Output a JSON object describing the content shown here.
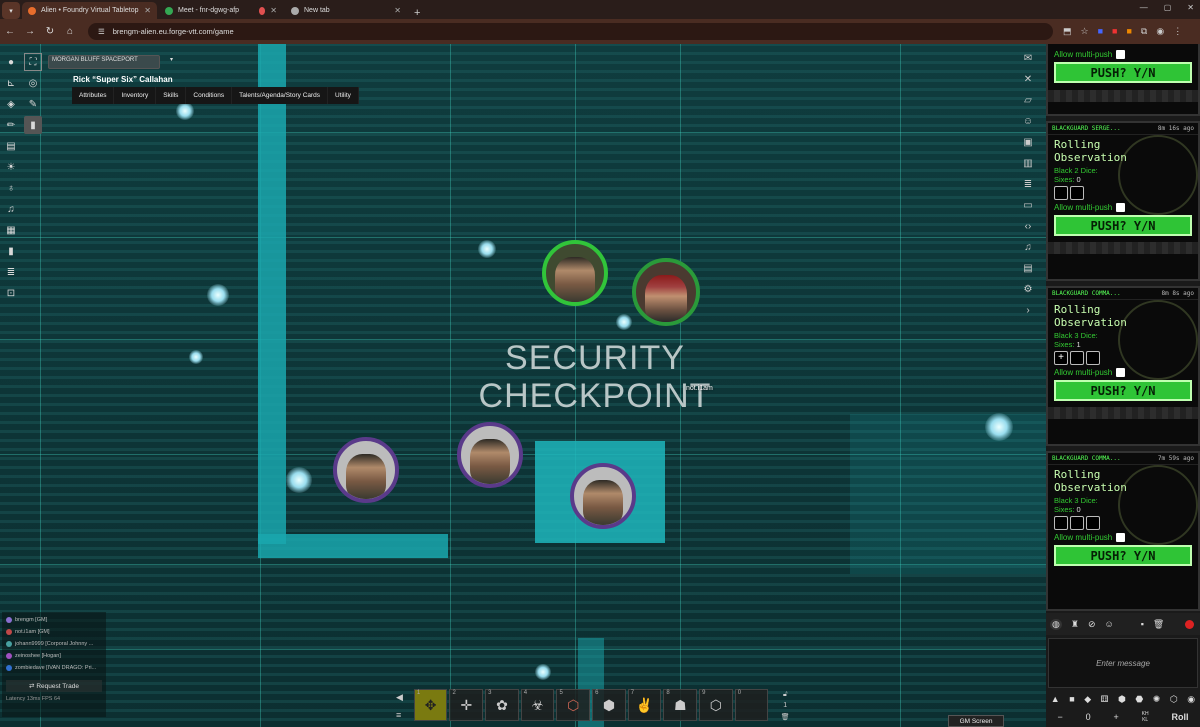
{
  "browser": {
    "tabs": [
      {
        "title": "Alien • Foundry Virtual Tabletop",
        "active": true,
        "favicon_color": "#e86d2c"
      },
      {
        "title": "Meet - fnr-dgwg-afp",
        "active": false,
        "favicon_color": "#34a853"
      },
      {
        "title": "",
        "active": false,
        "favicon_color": "#e05050"
      },
      {
        "title": "New tab",
        "active": false,
        "favicon_color": "#aaaaaa"
      }
    ],
    "url": "brengm-alien.eu.forge-vtt.com/game"
  },
  "scene": {
    "navigation_label": "MORGAN BLUFF SPACEPORT",
    "label_line1": "SECURITY",
    "label_line2": "CHECKPOINT",
    "tooltip": "not.i1am"
  },
  "sheet": {
    "character_name": "Rick “Super Six” Callahan",
    "tabs": [
      "Attributes",
      "Inventory",
      "Skills",
      "Conditions",
      "Talents/Agenda/Story Cards",
      "Utility"
    ]
  },
  "players": [
    {
      "name": "brengm [GM]",
      "color": "#8a6fd0"
    },
    {
      "name": "not.i1am [GM]",
      "color": "#c04848"
    },
    {
      "name": "johann9999 [Corporal Johnny ...",
      "color": "#48a0a0"
    },
    {
      "name": "zeinoshee [Hogan]",
      "color": "#a050c0"
    },
    {
      "name": "zombiedave [IVAN DRAGO: Pri...",
      "color": "#3070d0"
    }
  ],
  "request_trade_label": "Request Trade",
  "latency_text": "Latency  13ms  FPS  64",
  "hotbar": {
    "slots": [
      "1",
      "2",
      "3",
      "4",
      "5",
      "6",
      "7",
      "8",
      "9",
      "0"
    ],
    "page": "1"
  },
  "chat_cards": [
    {
      "header": "",
      "time": "",
      "title_line1": "",
      "title_line2": "",
      "dice_label": "",
      "sixes_label": "",
      "sixes_value": "",
      "dice": [],
      "multi_push_label": "Allow multi-push",
      "push_label": "PUSH? Y/N"
    },
    {
      "header": "BLACKGUARD SERGE...",
      "time": "8m 16s ago",
      "title_line1": "Rolling",
      "title_line2": "Observation",
      "dice_label": "Black 2 Dice:",
      "sixes_label": "Sixes:",
      "sixes_value": "0",
      "dice": [
        "",
        ""
      ],
      "multi_push_label": "Allow multi-push",
      "push_label": "PUSH? Y/N"
    },
    {
      "header": "BLACKGUARD COMMA...",
      "time": "8m 8s ago",
      "title_line1": "Rolling",
      "title_line2": "Observation",
      "dice_label": "Black 3 Dice:",
      "sixes_label": "Sixes:",
      "sixes_value": "1",
      "dice": [
        "+",
        "",
        ""
      ],
      "multi_push_label": "Allow multi-push",
      "push_label": "PUSH? Y/N"
    },
    {
      "header": "BLACKGUARD COMMA...",
      "time": "7m 59s ago",
      "title_line1": "Rolling",
      "title_line2": "Observation",
      "dice_label": "Black 3 Dice:",
      "sixes_label": "Sixes:",
      "sixes_value": "0",
      "dice": [
        "",
        "",
        ""
      ],
      "multi_push_label": "Allow multi-push",
      "push_label": "PUSH? Y/N"
    }
  ],
  "chat_input_placeholder": "Enter message",
  "dice_roller": {
    "count": "0",
    "roll_label": "Roll",
    "kh_label": "KH",
    "kl_label": "KL"
  },
  "gm_screen_label": "GM Screen"
}
